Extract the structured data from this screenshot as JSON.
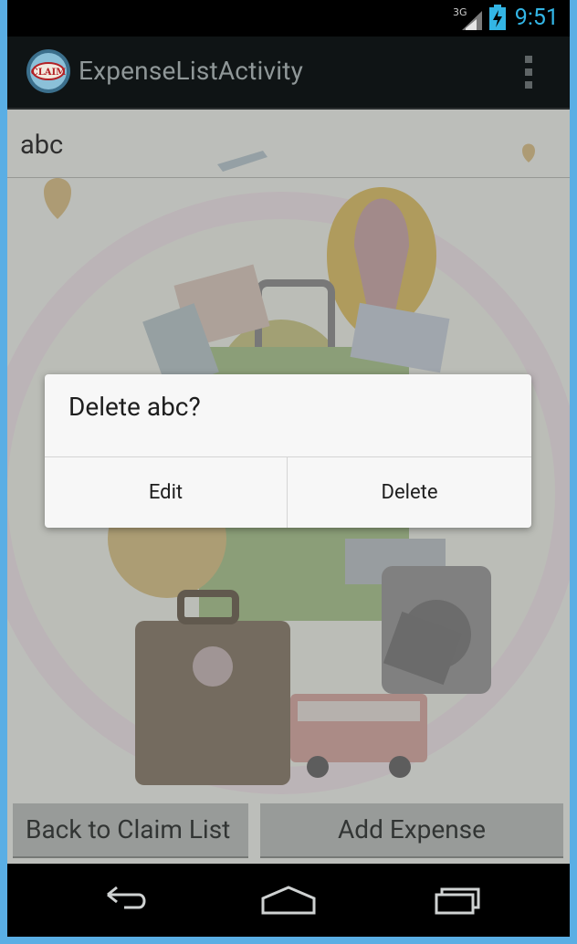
{
  "status_bar": {
    "time": "9:51",
    "network": "3G"
  },
  "action_bar": {
    "title": "ExpenseListActivity",
    "logo_text": "CLAIM"
  },
  "list": {
    "items": [
      {
        "label": "abc"
      }
    ]
  },
  "bottom_buttons": {
    "back_label": "Back to Claim List",
    "add_label": "Add Expense"
  },
  "dialog": {
    "title": "Delete abc?",
    "edit_label": "Edit",
    "delete_label": "Delete"
  },
  "colors": {
    "status_accent": "#33b5e5",
    "frame": "#5aaee4",
    "dialog_bg": "#f7f7f7"
  },
  "nav_icons": [
    "back-icon",
    "home-icon",
    "recents-icon"
  ]
}
